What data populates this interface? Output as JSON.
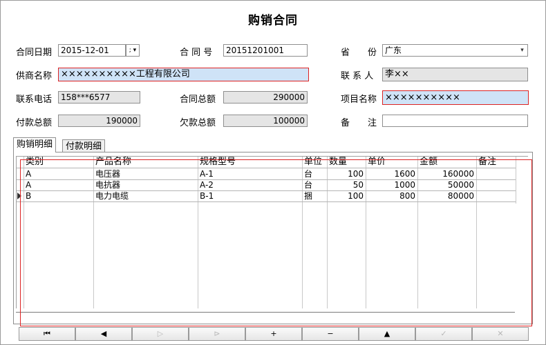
{
  "title": "购销合同",
  "form": {
    "contract_date_label": "合同日期",
    "contract_date_value": "2015-12-01",
    "contract_no_label": "合 同 号",
    "contract_no_value": "20151201001",
    "province_label": "省　　份",
    "province_value": "广东",
    "supplier_label": "供商名称",
    "supplier_value": "××××××××××工程有限公司",
    "contact_label": "联 系 人",
    "contact_value": "李××",
    "phone_label": "联系电话",
    "phone_value": "158***6577",
    "total_label": "合同总额",
    "total_value": "290000",
    "project_label": "项目名称",
    "project_value": "××××××××××",
    "paid_label": "付款总额",
    "paid_value": "190000",
    "owed_label": "欠款总额",
    "owed_value": "100000",
    "remark_label": "备　　注",
    "remark_value": ""
  },
  "tabs": [
    {
      "label": "购销明细"
    },
    {
      "label": "付款明细"
    }
  ],
  "grid": {
    "columns": [
      "类别",
      "产品名称",
      "规格型号",
      "单位",
      "数量",
      "单价",
      "金额",
      "备注"
    ],
    "rows": [
      {
        "category": "A",
        "product": "电压器",
        "spec": "A-1",
        "unit": "台",
        "qty": "100",
        "price": "1600",
        "amount": "160000",
        "remark": ""
      },
      {
        "category": "A",
        "product": "电抗器",
        "spec": "A-2",
        "unit": "台",
        "qty": "50",
        "price": "1000",
        "amount": "50000",
        "remark": ""
      },
      {
        "category": "B",
        "product": "电力电缆",
        "spec": "B-1",
        "unit": "捆",
        "qty": "100",
        "price": "800",
        "amount": "80000",
        "remark": ""
      }
    ]
  },
  "navigator": {
    "buttons": [
      {
        "name": "first-record",
        "glyph": "⏮",
        "enabled": true
      },
      {
        "name": "prior-record",
        "glyph": "◀",
        "enabled": true
      },
      {
        "name": "next-record",
        "glyph": "▷",
        "enabled": false
      },
      {
        "name": "last-record",
        "glyph": "⊳",
        "enabled": false
      },
      {
        "name": "insert-record",
        "glyph": "+",
        "enabled": true
      },
      {
        "name": "delete-record",
        "glyph": "−",
        "enabled": true
      },
      {
        "name": "edit-record",
        "glyph": "▲",
        "enabled": true
      },
      {
        "name": "post-record",
        "glyph": "✓",
        "enabled": false
      },
      {
        "name": "cancel-record",
        "glyph": "✕",
        "enabled": false
      }
    ]
  },
  "colors": {
    "highlight_fill": "#cfe3f7",
    "highlight_border": "#dd2222",
    "readonly_fill": "#e5e5e5"
  }
}
